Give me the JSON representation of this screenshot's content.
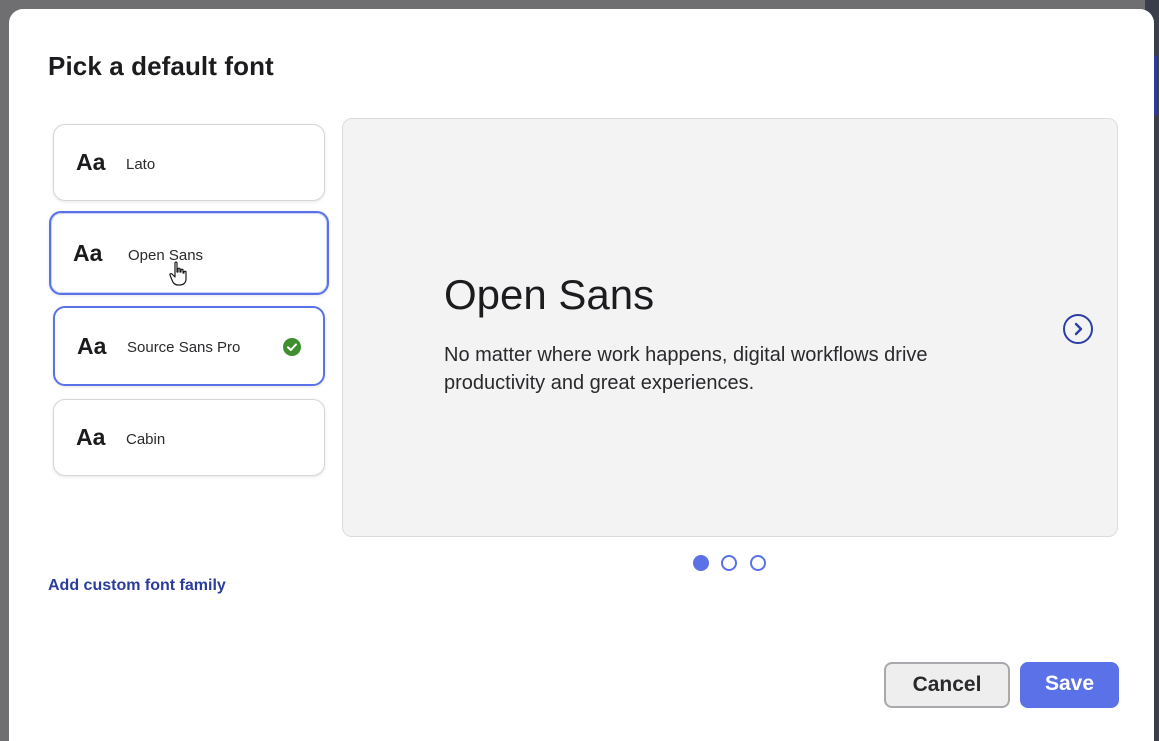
{
  "dialog": {
    "title": "Pick a default font"
  },
  "font_options": [
    {
      "sample": "Aa",
      "name": "Lato",
      "state": "default"
    },
    {
      "sample": "Aa",
      "name": "Open Sans",
      "state": "hovered"
    },
    {
      "sample": "Aa",
      "name": "Source Sans Pro",
      "state": "selected"
    },
    {
      "sample": "Aa",
      "name": "Cabin",
      "state": "default"
    }
  ],
  "preview": {
    "font_name": "Open Sans",
    "sample_text": "No matter where work happens, digital workflows drive productivity and great experiences.",
    "current_page": 1,
    "page_count": 3
  },
  "actions": {
    "add_custom_label": "Add custom font family",
    "cancel_label": "Cancel",
    "save_label": "Save"
  },
  "colors": {
    "accent": "#5a71e8",
    "link": "#2b3d9c",
    "check": "#3f8f2f",
    "preview_bg": "#f3f3f4"
  },
  "icons": {
    "selected": "check-circle-icon",
    "next": "chevron-right-circle-icon",
    "cursor": "hand-pointer-icon"
  }
}
